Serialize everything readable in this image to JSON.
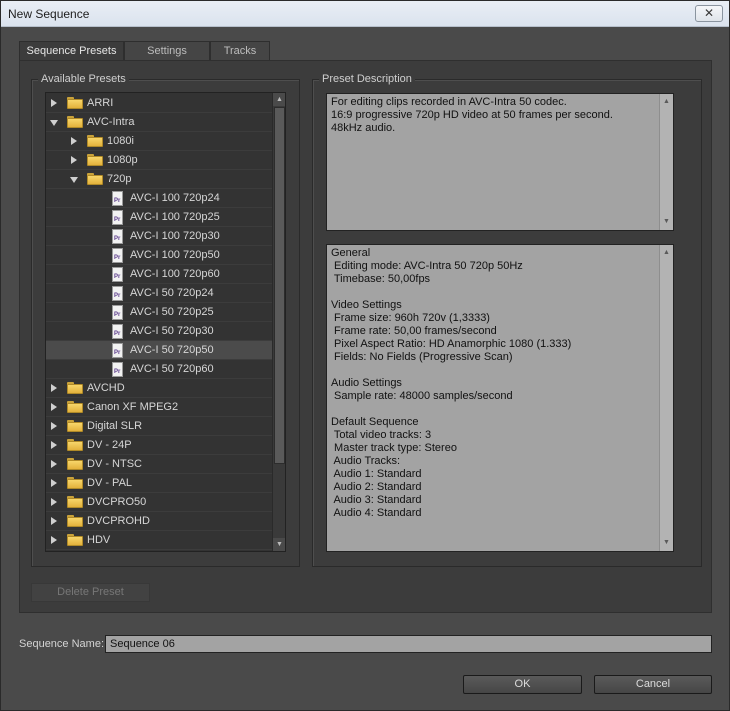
{
  "window": {
    "title": "New Sequence",
    "close_glyph": "✕"
  },
  "tabs": [
    {
      "label": "Sequence Presets",
      "active": true
    },
    {
      "label": "Settings",
      "active": false
    },
    {
      "label": "Tracks",
      "active": false
    }
  ],
  "presets": {
    "legend": "Available Presets",
    "items": [
      {
        "label": "ARRI",
        "kind": "folder",
        "depth": 0,
        "state": "collapsed"
      },
      {
        "label": "AVC-Intra",
        "kind": "folder",
        "depth": 0,
        "state": "expanded"
      },
      {
        "label": "1080i",
        "kind": "folder",
        "depth": 1,
        "state": "collapsed"
      },
      {
        "label": "1080p",
        "kind": "folder",
        "depth": 1,
        "state": "collapsed"
      },
      {
        "label": "720p",
        "kind": "folder",
        "depth": 1,
        "state": "expanded"
      },
      {
        "label": "AVC-I 100 720p24",
        "kind": "preset",
        "depth": 2
      },
      {
        "label": "AVC-I 100 720p25",
        "kind": "preset",
        "depth": 2
      },
      {
        "label": "AVC-I 100 720p30",
        "kind": "preset",
        "depth": 2
      },
      {
        "label": "AVC-I 100 720p50",
        "kind": "preset",
        "depth": 2
      },
      {
        "label": "AVC-I 100 720p60",
        "kind": "preset",
        "depth": 2
      },
      {
        "label": "AVC-I 50 720p24",
        "kind": "preset",
        "depth": 2
      },
      {
        "label": "AVC-I 50 720p25",
        "kind": "preset",
        "depth": 2
      },
      {
        "label": "AVC-I 50 720p30",
        "kind": "preset",
        "depth": 2
      },
      {
        "label": "AVC-I 50 720p50",
        "kind": "preset",
        "depth": 2,
        "selected": true
      },
      {
        "label": "AVC-I 50 720p60",
        "kind": "preset",
        "depth": 2
      },
      {
        "label": "AVCHD",
        "kind": "folder",
        "depth": 0,
        "state": "collapsed"
      },
      {
        "label": "Canon XF MPEG2",
        "kind": "folder",
        "depth": 0,
        "state": "collapsed"
      },
      {
        "label": "Digital SLR",
        "kind": "folder",
        "depth": 0,
        "state": "collapsed"
      },
      {
        "label": "DV - 24P",
        "kind": "folder",
        "depth": 0,
        "state": "collapsed"
      },
      {
        "label": "DV - NTSC",
        "kind": "folder",
        "depth": 0,
        "state": "collapsed"
      },
      {
        "label": "DV - PAL",
        "kind": "folder",
        "depth": 0,
        "state": "collapsed"
      },
      {
        "label": "DVCPRO50",
        "kind": "folder",
        "depth": 0,
        "state": "collapsed"
      },
      {
        "label": "DVCPROHD",
        "kind": "folder",
        "depth": 0,
        "state": "collapsed"
      },
      {
        "label": "HDV",
        "kind": "folder",
        "depth": 0,
        "state": "collapsed"
      }
    ],
    "delete_label": "Delete Preset",
    "file_badge": "Pr"
  },
  "description": {
    "legend": "Preset Description",
    "summary": "For editing clips recorded in AVC-Intra 50 codec.\n16:9 progressive 720p HD video at 50 frames per second.\n48kHz audio.",
    "details": "General\n Editing mode: AVC-Intra 50 720p 50Hz\n Timebase: 50,00fps\n\nVideo Settings\n Frame size: 960h 720v (1,3333)\n Frame rate: 50,00 frames/second\n Pixel Aspect Ratio: HD Anamorphic 1080 (1.333)\n Fields: No Fields (Progressive Scan)\n\nAudio Settings\n Sample rate: 48000 samples/second\n\nDefault Sequence\n Total video tracks: 3\n Master track type: Stereo\n Audio Tracks:\n Audio 1: Standard\n Audio 2: Standard\n Audio 3: Standard\n Audio 4: Standard"
  },
  "sequence_name": {
    "label": "Sequence Name:",
    "value": "Sequence 06"
  },
  "buttons": {
    "ok": "OK",
    "cancel": "Cancel"
  },
  "colors": {
    "folder": "#e3b23c",
    "background": "#4a4a4a",
    "panel": "#3c3c3c",
    "text_field": "#a3a3a3"
  }
}
